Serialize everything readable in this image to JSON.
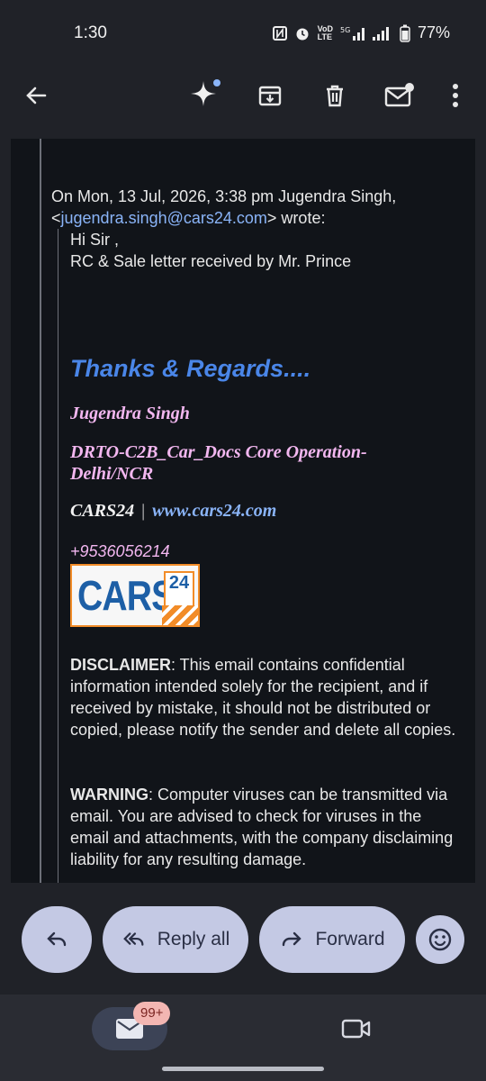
{
  "status_bar": {
    "time": "1:30",
    "battery": "77%"
  },
  "toolbar": {
    "icons": [
      "back-icon",
      "sparkle-icon",
      "archive-icon",
      "delete-icon",
      "mark-unread-icon",
      "more-icon"
    ]
  },
  "email": {
    "quote_header": "On Mon, 13 Jul, 2026, 3:38 pm Jugendra Singh,",
    "quote_lt": "<",
    "quote_email": "jugendra.singh@cars24.com",
    "quote_wrote": "> wrote:",
    "greeting": "Hi Sir ,",
    "message": "RC & Sale letter received by Mr. Prince",
    "signature": {
      "thanks": "Thanks & Regards....",
      "name": "Jugendra Singh",
      "department": "DRTO-C2B_Car_Docs Core Operation-Delhi/NCR",
      "company": "CARS24",
      "pipe": "|",
      "website": "www.cars24.com",
      "phone": "+9536056214",
      "logo_text": "CARS",
      "logo_number": "24"
    },
    "disclaimer_label": "DISCLAIMER",
    "disclaimer_text": ": This email contains confidential information intended solely for the recipient, and if received by mistake, it should not be distributed or copied, please notify the sender and delete all copies.",
    "warning_label": "WARNING",
    "warning_text": ": Computer viruses can be transmitted via email. You are advised to check for viruses in the email and attachments, with the company disclaiming liability for any resulting damage."
  },
  "actions": {
    "reply_label": "",
    "reply_all_label": "Reply all",
    "forward_label": "Forward"
  },
  "bottom_nav": {
    "mail_badge": "99+"
  },
  "colors": {
    "background": "#202228",
    "email_bg": "#111419",
    "pill_bg": "#c4c9e4",
    "link": "#8ab4f8",
    "signature_pink": "#f3b7f0",
    "thanks_blue": "#4a86e8",
    "logo_orange": "#f28c28",
    "logo_blue": "#1d5fa6"
  }
}
